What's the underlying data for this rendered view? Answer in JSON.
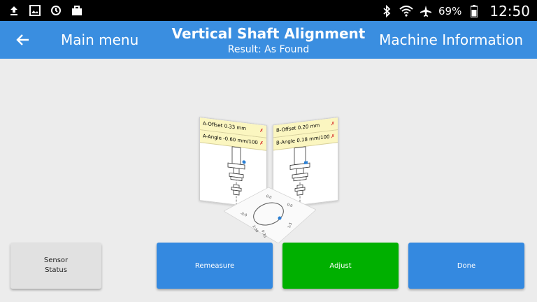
{
  "status_bar": {
    "left_icons": [
      "upload-icon",
      "image-icon",
      "sync-icon",
      "briefcase-icon"
    ],
    "right_icons": [
      "bluetooth-icon",
      "wifi-icon",
      "airplane-icon"
    ],
    "battery": "69%",
    "time": "12:50"
  },
  "app_bar": {
    "back_icon": "arrow-left-icon",
    "main_menu": "Main menu",
    "title": "Vertical Shaft Alignment",
    "subtitle": "Result: As Found",
    "machine_info": "Machine Information"
  },
  "result": {
    "a_offset": "A-Offset 0.33 mm",
    "a_angle": "A-Angle -0.60 mm/100",
    "b_offset": "B-Offset 0.20 mm",
    "b_angle": "B-Angle 0.18 mm/100",
    "fail_mark": "✗",
    "dial_labels": [
      "0:0",
      "0:0",
      "-0:0",
      "1:3",
      "2:30",
      "0:30"
    ]
  },
  "buttons": {
    "sensor_status_line1": "Sensor",
    "sensor_status_line2": "Status",
    "remeasure": "Remeasure",
    "adjust": "Adjust",
    "done": "Done"
  },
  "colors": {
    "app_bar": "#3a8ee0",
    "button_blue": "#3489e0",
    "button_green": "#00b000",
    "readout_bg": "#fbf6c0",
    "fail_red": "#d62a2a"
  }
}
